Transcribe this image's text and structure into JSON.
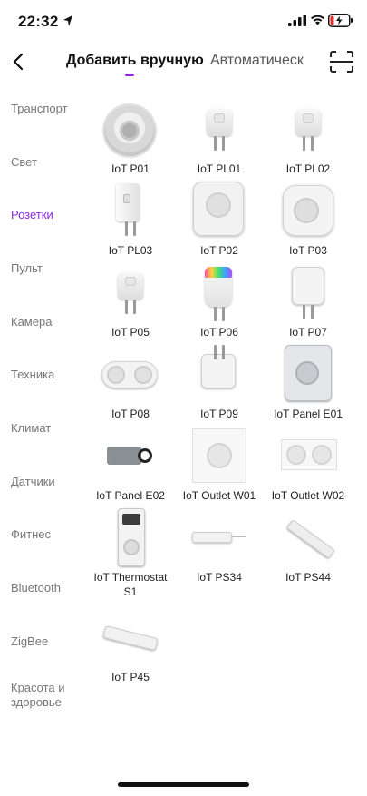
{
  "status_bar": {
    "time": "22:32",
    "icons": [
      "location-arrow-icon",
      "cellular-signal-icon",
      "wifi-icon",
      "battery-charging-icon"
    ],
    "battery_color": "#e0302a"
  },
  "header": {
    "tabs": [
      {
        "label": "Добавить вручную",
        "active": true
      },
      {
        "label": "Автоматическ",
        "active": false
      }
    ],
    "accent_color": "#8a2be2"
  },
  "categories": [
    {
      "label": "Транспорт",
      "active": false
    },
    {
      "label": "Свет",
      "active": false
    },
    {
      "label": "Розетки",
      "active": true
    },
    {
      "label": "Пульт",
      "active": false
    },
    {
      "label": "Камера",
      "active": false
    },
    {
      "label": "Техника",
      "active": false
    },
    {
      "label": "Климат",
      "active": false
    },
    {
      "label": "Датчики",
      "active": false
    },
    {
      "label": "Фитнес",
      "active": false
    },
    {
      "label": "Bluetooth",
      "active": false
    },
    {
      "label": "ZigBee",
      "active": false
    },
    {
      "label": "Красота и здоровье",
      "active": false
    }
  ],
  "products": [
    {
      "label": "IoT P01"
    },
    {
      "label": "IoT PL01"
    },
    {
      "label": "IoT PL02"
    },
    {
      "label": "IoT PL03"
    },
    {
      "label": "IoT P02"
    },
    {
      "label": "IoT P03"
    },
    {
      "label": "IoT P05"
    },
    {
      "label": "IoT P06"
    },
    {
      "label": "IoT P07"
    },
    {
      "label": "IoT P08"
    },
    {
      "label": "IoT P09"
    },
    {
      "label": "IoT Panel E01"
    },
    {
      "label": "IoT Panel E02"
    },
    {
      "label": "IoT Outlet W01"
    },
    {
      "label": "IoT Outlet W02"
    },
    {
      "label": "IoT Thermostat S1"
    },
    {
      "label": "IoT PS34"
    },
    {
      "label": "IoT PS44"
    },
    {
      "label": "IoT P45"
    }
  ]
}
